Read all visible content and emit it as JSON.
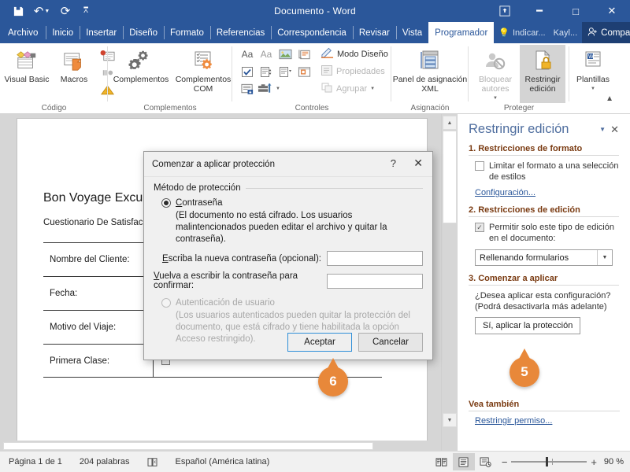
{
  "titlebar": {
    "document_title": "Documento - Word",
    "qat": [
      {
        "name": "save",
        "glyph": "💾"
      },
      {
        "name": "undo",
        "glyph": "↶"
      },
      {
        "name": "redo",
        "glyph": "↻"
      },
      {
        "name": "customize",
        "glyph": "⩞"
      }
    ],
    "window_controls": [
      {
        "name": "ribbon-display-options",
        "glyph": "⬆"
      },
      {
        "name": "minimize",
        "glyph": "─"
      },
      {
        "name": "maximize",
        "glyph": "□"
      },
      {
        "name": "close",
        "glyph": "✕"
      }
    ]
  },
  "tabs": [
    {
      "label": "Archivo",
      "active": false
    },
    {
      "label": "Inicio",
      "active": false
    },
    {
      "label": "Insertar",
      "active": false
    },
    {
      "label": "Diseño",
      "active": false
    },
    {
      "label": "Formato",
      "active": false
    },
    {
      "label": "Referencias",
      "active": false
    },
    {
      "label": "Correspondencia",
      "active": false
    },
    {
      "label": "Revisar",
      "active": false
    },
    {
      "label": "Vista",
      "active": false
    },
    {
      "label": "Programador",
      "active": true
    }
  ],
  "tellme": {
    "label": "Indicar...",
    "icon": "lightbulb-icon"
  },
  "account": {
    "label": "Kayl..."
  },
  "share": {
    "label": "Compartir",
    "icon": "share-person-icon"
  },
  "ribbon": {
    "groups": [
      {
        "name": "codigo",
        "label": "Código"
      },
      {
        "name": "complementos",
        "label": "Complementos"
      },
      {
        "name": "controles",
        "label": "Controles"
      },
      {
        "name": "asignacion",
        "label": "Asignación"
      },
      {
        "name": "proteger",
        "label": "Proteger"
      },
      {
        "name": "plantillas",
        "label": ""
      }
    ],
    "visual_basic": "Visual Basic",
    "macros": "Macros",
    "complementos": "Complementos",
    "complementos_com": "Complementos COM",
    "modo_diseno": "Modo Diseño",
    "propiedades": "Propiedades",
    "agrupar": "Agrupar",
    "panel_xml": "Panel de asignación XML",
    "bloquear_autores": "Bloquear autores",
    "restringir_edicion": "Restringir edición",
    "plantillas": "Plantillas"
  },
  "document": {
    "title": "Bon Voyage Excursions",
    "subtitle": "Cuestionario De Satisfacción Del Cliente",
    "rows": [
      {
        "label": "Nombre del Cliente:",
        "value": ""
      },
      {
        "label": "Fecha:",
        "value": ""
      },
      {
        "label": "Motivo del Viaje:",
        "value": ""
      },
      {
        "label": "Primera Clase:",
        "value": ""
      }
    ]
  },
  "pane": {
    "title": "Restringir edición",
    "section1_heading": "1. Restricciones de formato",
    "limit_format_label": "Limitar el formato a una selección de estilos",
    "limit_format_checked": false,
    "settings_link": "Configuración...",
    "section2_heading": "2. Restricciones de edición",
    "allow_only_label": "Permitir solo este tipo de edición en el documento:",
    "allow_only_checked": true,
    "edit_type_value": "Rellenando formularios",
    "section3_heading": "3. Comenzar a aplicar",
    "apply_question": "¿Desea aplicar esta configuración? (Podrá desactivarla más adelante)",
    "apply_button": "Sí, aplicar la protección",
    "see_also_heading": "Vea también",
    "see_also_link": "Restringir permiso..."
  },
  "dialog": {
    "title": "Comenzar a aplicar protección",
    "help_glyph": "?",
    "close_glyph": "✕",
    "group_label": "Método de protección",
    "password_radio_label": "Contraseña",
    "password_radio_selected": true,
    "password_hint": "(El documento no está cifrado. Los usuarios malintencionados pueden editar el archivo y quitar la contraseña).",
    "new_password_label": "Escriba la nueva contraseña (opcional):",
    "new_password_value": "",
    "confirm_password_label": "Vuelva a escribir la contraseña para confirmar:",
    "confirm_password_value": "",
    "user_auth_radio_label": "Autenticación de usuario",
    "user_auth_disabled": true,
    "user_auth_hint": "(Los usuarios autenticados pueden quitar la protección del documento, que está cifrado y tiene habilitada la opción Acceso restringido).",
    "ok_button": "Aceptar",
    "cancel_button": "Cancelar"
  },
  "callouts": [
    {
      "name": "callout-6",
      "number": "6"
    },
    {
      "name": "callout-5",
      "number": "5"
    }
  ],
  "statusbar": {
    "page": "Página 1 de 1",
    "words": "204 palabras",
    "proofing_icon": "proofing-errors-icon",
    "language": "Español (América latina)",
    "views": [
      {
        "name": "read-mode",
        "glyph": "📖",
        "selected": false
      },
      {
        "name": "print-layout",
        "glyph": "☰",
        "selected": true
      },
      {
        "name": "web-layout",
        "glyph": "🗎",
        "selected": false
      }
    ],
    "zoom_out": "−",
    "zoom_in": "+",
    "zoom_level": "90 %"
  },
  "colors": {
    "accent": "#2b579a",
    "callout": "#e8883a",
    "pane_heading": "#7a3b12",
    "link": "#2b579a"
  }
}
